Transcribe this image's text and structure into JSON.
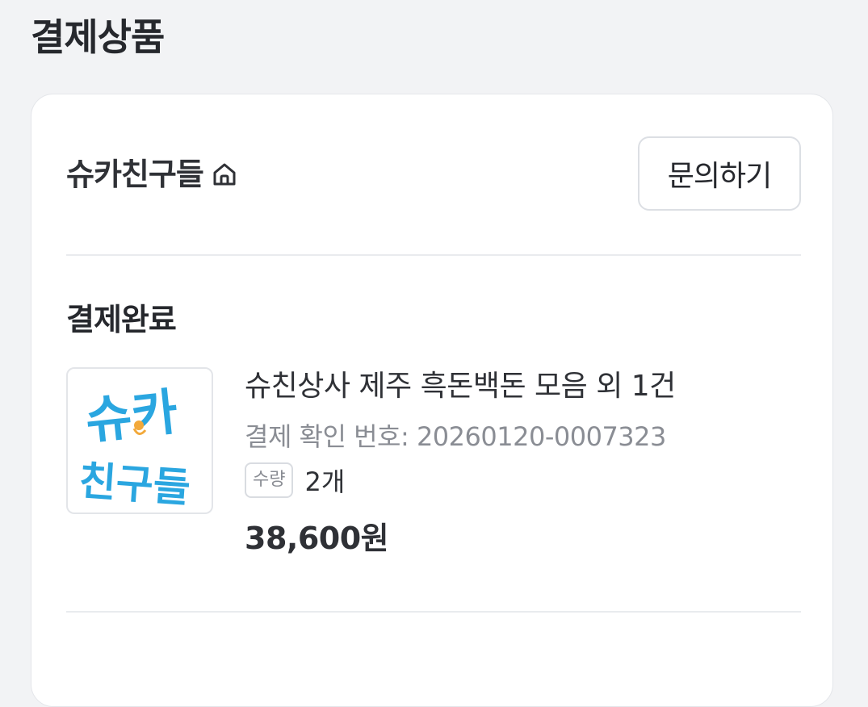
{
  "page": {
    "title": "결제상품"
  },
  "seller": {
    "name": "슈카친구들",
    "home_icon": "home-icon",
    "inquiry_label": "문의하기"
  },
  "order": {
    "status": "결제완료",
    "product_name": "슈친상사 제주 흑돈백돈 모음 외 1건",
    "confirm_label": "결제 확인 번호:",
    "confirm_number": "20260120-0007323",
    "quantity_label": "수량",
    "quantity_value": "2개",
    "price": "38,600원",
    "thumbnail": {
      "logo_text_top": "슈카",
      "logo_text_bottom": "친구들",
      "logo_color": "#2aa6e0",
      "accent_color": "#f2a93b"
    }
  }
}
